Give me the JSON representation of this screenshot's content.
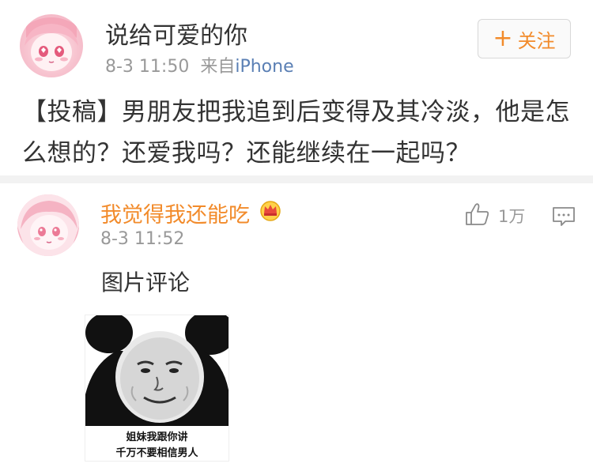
{
  "post": {
    "author": "说给可爱的你",
    "time": "8-3 11:50",
    "source_prefix": "来自",
    "source_device": "iPhone",
    "follow_plus": "+",
    "follow_label": "关注",
    "text": "【投稿】男朋友把我追到后变得及其冷淡，他是怎么想的？还爱我吗？还能继续在一起吗？"
  },
  "comment": {
    "author": "我觉得我还能吃",
    "time": "8-3 11:52",
    "like_count": "1万",
    "text": "图片评论",
    "meme_caption_line1": "姐妹我跟你讲",
    "meme_caption_line2": "千万不要相信男人"
  },
  "colors": {
    "accent_orange": "#f28b2b",
    "link_blue": "#5a7fb4",
    "meta_gray": "#999999",
    "divider": "#f2f2f2"
  },
  "icons": {
    "crown": "crown-badge-icon",
    "like": "thumbs-up-icon",
    "reply": "comment-bubble-icon"
  }
}
